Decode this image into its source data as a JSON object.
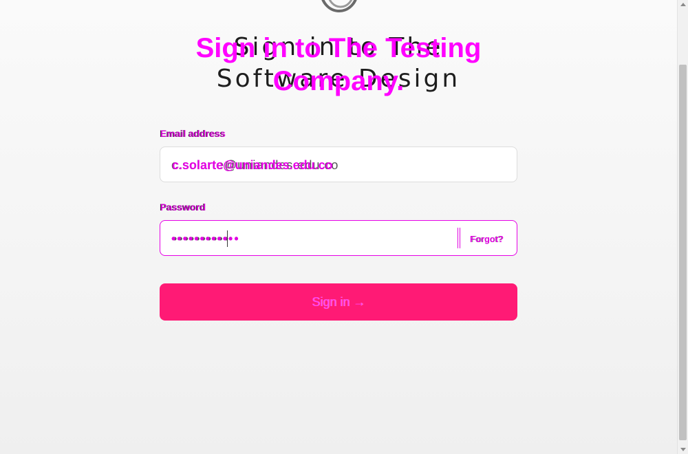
{
  "title": {
    "text": "Sign in to The Software Design",
    "overlay_text": "Sign in to The Testing Company."
  },
  "form": {
    "email_label": "Email address",
    "email_value": "c.solarte@uniandes.edu.co",
    "password_label": "Password",
    "password_mask": "••••••••••",
    "password_mask_overlay": "••••••••••••",
    "forgot_label": "Forgot?"
  },
  "actions": {
    "signin_label": "Sign in →"
  },
  "icons": {
    "logo": "ring-logo-icon",
    "scroll_up": "scroll-up-arrow-icon",
    "scroll_down": "scroll-down-arrow-icon"
  },
  "colors": {
    "accent": "#ff1a75",
    "overlay_magenta": "#ff00ff",
    "title_dark": "#1e1e1e"
  }
}
